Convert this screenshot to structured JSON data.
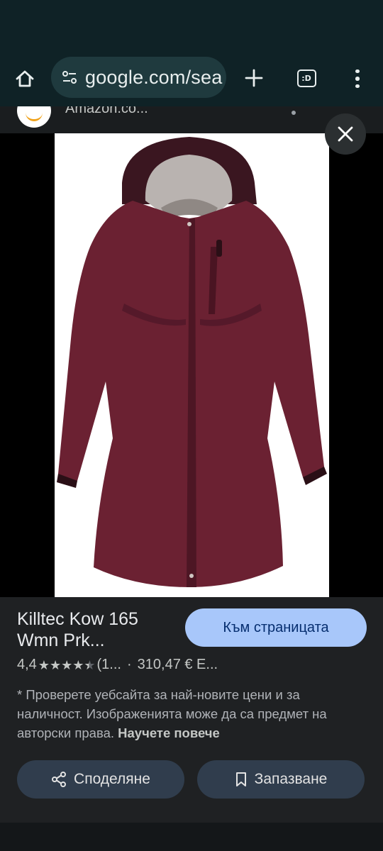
{
  "browser": {
    "url_text": "google.com/sea",
    "tabs_label": ":D"
  },
  "result": {
    "source_title": "Amazon.co..."
  },
  "product": {
    "title": "Killtec Kow 165 Wmn Prk...",
    "visit_button": "Към страницата",
    "rating": "4,4",
    "stars_filled": 4.4,
    "reviews": "(1...",
    "price": "310,47 € E...",
    "disclaimer": "* Проверете уебсайта за най-новите цени и за наличност. Изображенията може да са предмет на авторски права.",
    "learn_more": "Научете повече"
  },
  "actions": {
    "share_label": "Споделяне",
    "save_label": "Запазване"
  },
  "colors": {
    "toolbar_bg": "#0f2226",
    "omnibox_bg": "#1f3a3e",
    "panel_bg": "#1f2123",
    "primary_button": "#a8c7fa",
    "secondary_button": "#303d4d",
    "jacket": "#6b2132"
  }
}
